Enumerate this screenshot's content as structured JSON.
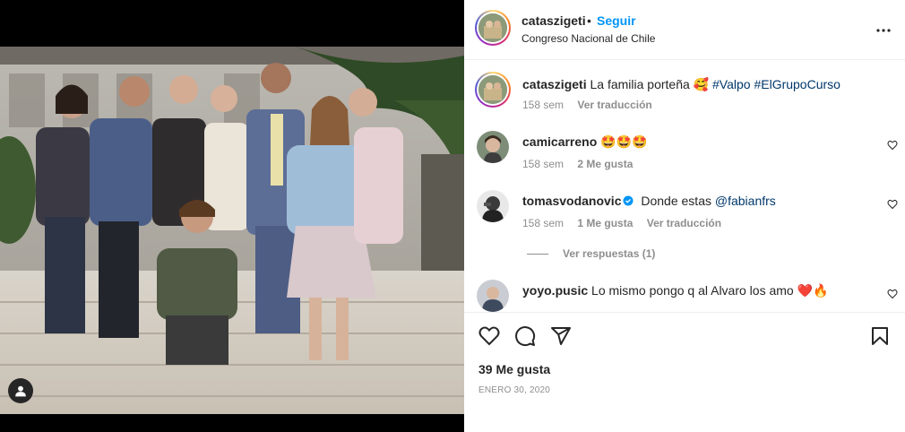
{
  "post": {
    "username": "cataszigeti",
    "dot": "•",
    "follow_label": "Seguir",
    "location": "Congreso Nacional de Chile",
    "more_icon": "more-horizontal-icon",
    "user_tag_icon": "user-tag-icon"
  },
  "caption": {
    "username": "cataszigeti",
    "text": "La familia porteña 🥰",
    "hashtag1": "#Valpo",
    "hashtag2": "#ElGrupoCurso",
    "time": "158 sem",
    "translate": "Ver traducción"
  },
  "comments": [
    {
      "username": "camicarreno",
      "text": "🤩🤩🤩",
      "time": "158 sem",
      "likes": "2 Me gusta"
    },
    {
      "username": "tomasvodanovic",
      "verified": true,
      "text": "Donde estas",
      "mention": "@fabianfrs",
      "time": "158 sem",
      "likes": "1 Me gusta",
      "translate": "Ver traducción",
      "replies": "Ver respuestas (1)"
    },
    {
      "username": "yoyo.pusic",
      "text": "Lo mismo pongo q al Alvaro los amo ❤️🔥"
    }
  ],
  "footer": {
    "likes": "39 Me gusta",
    "date": "ENERO 30, 2020",
    "icons": [
      "heart-icon",
      "comment-icon",
      "share-icon",
      "bookmark-icon"
    ]
  },
  "colors": {
    "follow": "#0095f6",
    "link": "#00376b",
    "muted": "#8e8e8e",
    "text": "#262626",
    "verified": "#0095f6"
  }
}
